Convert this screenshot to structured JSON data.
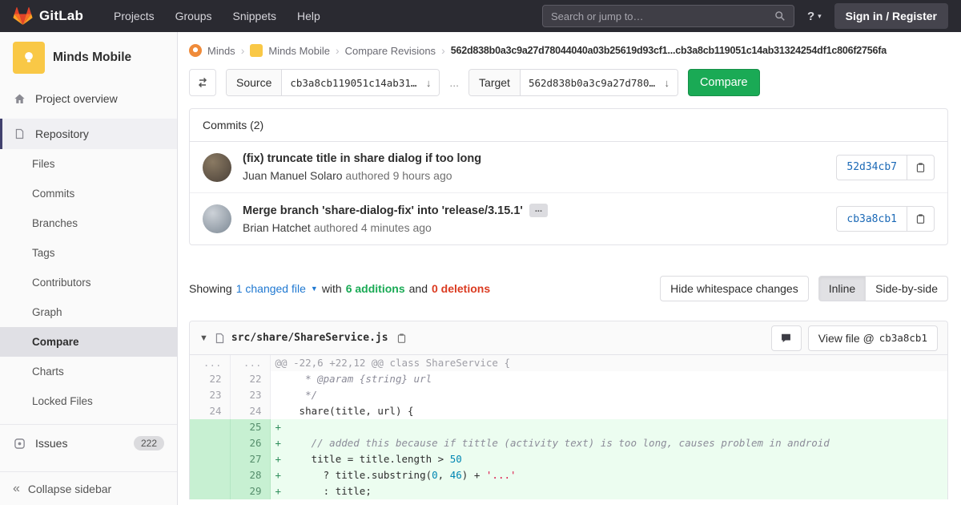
{
  "colors": {
    "navbar_bg": "#2a2a31",
    "accent_blue": "#1f78d1",
    "green": "#1aaa55",
    "red": "#db3b21",
    "added_line_bg": "#ecfdf0",
    "added_gutter_bg": "#c7f0d2"
  },
  "navbar": {
    "logo_text": "GitLab",
    "items": [
      "Projects",
      "Groups",
      "Snippets",
      "Help"
    ],
    "search_placeholder": "Search or jump to…",
    "help_icon": "?",
    "signin_label": "Sign in / Register"
  },
  "sidebar": {
    "project_name": "Minds Mobile",
    "overview_label": "Project overview",
    "repository_label": "Repository",
    "repo_items": [
      "Files",
      "Commits",
      "Branches",
      "Tags",
      "Contributors",
      "Graph",
      "Compare",
      "Charts",
      "Locked Files"
    ],
    "active_repo_item": "Compare",
    "issues_label": "Issues",
    "issues_count": "222",
    "collapse_label": "Collapse sidebar"
  },
  "breadcrumb": {
    "group": "Minds",
    "project": "Minds Mobile",
    "section": "Compare Revisions",
    "current": "562d838b0a3c9a27d78044040a03b25619d93cf1...cb3a8cb119051c14ab31324254df1c806f2756fa"
  },
  "compare_form": {
    "source_label": "Source",
    "source_value": "cb3a8cb119051c14ab31…",
    "separator": "...",
    "target_label": "Target",
    "target_value": "562d838b0a3c9a27d780…",
    "compare_button": "Compare"
  },
  "commits": {
    "header": "Commits (2)",
    "items": [
      {
        "title": "(fix) truncate title in share dialog if too long",
        "author": "Juan Manuel Solaro",
        "meta": "authored 9 hours ago",
        "sha": "52d34cb7"
      },
      {
        "title": "Merge branch 'share-dialog-fix' into 'release/3.15.1'",
        "expander": "...",
        "author": "Brian Hatchet",
        "meta": "authored 4 minutes ago",
        "sha": "cb3a8cb1"
      }
    ]
  },
  "summary": {
    "showing": "Showing",
    "changed_file": "1 changed file",
    "with_text": "with",
    "additions": "6 additions",
    "and_text": "and",
    "deletions": "0 deletions",
    "hide_whitespace": "Hide whitespace changes",
    "inline": "Inline",
    "side_by_side": "Side-by-side"
  },
  "diff": {
    "file_path": "src/share/ShareService.js",
    "view_file_label": "View file @",
    "view_file_sha": "cb3a8cb1",
    "lines": [
      {
        "type": "hunk",
        "old": "...",
        "new": "...",
        "segments": [
          {
            "t": "@@ -22,6 +22,12 @@ class ShareService {",
            "c": ""
          }
        ]
      },
      {
        "type": "ctx",
        "old": "22",
        "new": "22",
        "sign": " ",
        "segments": [
          {
            "t": "   * @param {string} url",
            "c": "cm"
          }
        ]
      },
      {
        "type": "ctx",
        "old": "23",
        "new": "23",
        "sign": " ",
        "segments": [
          {
            "t": "   */",
            "c": "cm"
          }
        ]
      },
      {
        "type": "ctx",
        "old": "24",
        "new": "24",
        "sign": " ",
        "segments": [
          {
            "t": "  share(title, url) {",
            "c": ""
          }
        ]
      },
      {
        "type": "add",
        "old": "",
        "new": "25",
        "sign": "+",
        "segments": [
          {
            "t": "",
            "c": ""
          }
        ]
      },
      {
        "type": "add",
        "old": "",
        "new": "26",
        "sign": "+",
        "segments": [
          {
            "t": "    // added this because if tittle (activity text) is too long, causes problem in android",
            "c": "cm"
          }
        ]
      },
      {
        "type": "add",
        "old": "",
        "new": "27",
        "sign": "+",
        "segments": [
          {
            "t": "    title = title.length > ",
            "c": ""
          },
          {
            "t": "50",
            "c": "num"
          }
        ]
      },
      {
        "type": "add",
        "old": "",
        "new": "28",
        "sign": "+",
        "segments": [
          {
            "t": "      ? title.substring(",
            "c": ""
          },
          {
            "t": "0",
            "c": "num"
          },
          {
            "t": ", ",
            "c": ""
          },
          {
            "t": "46",
            "c": "num"
          },
          {
            "t": ") + ",
            "c": ""
          },
          {
            "t": "'...'",
            "c": "str"
          }
        ]
      },
      {
        "type": "add",
        "old": "",
        "new": "29",
        "sign": "+",
        "segments": [
          {
            "t": "      : title;",
            "c": ""
          }
        ]
      }
    ]
  }
}
